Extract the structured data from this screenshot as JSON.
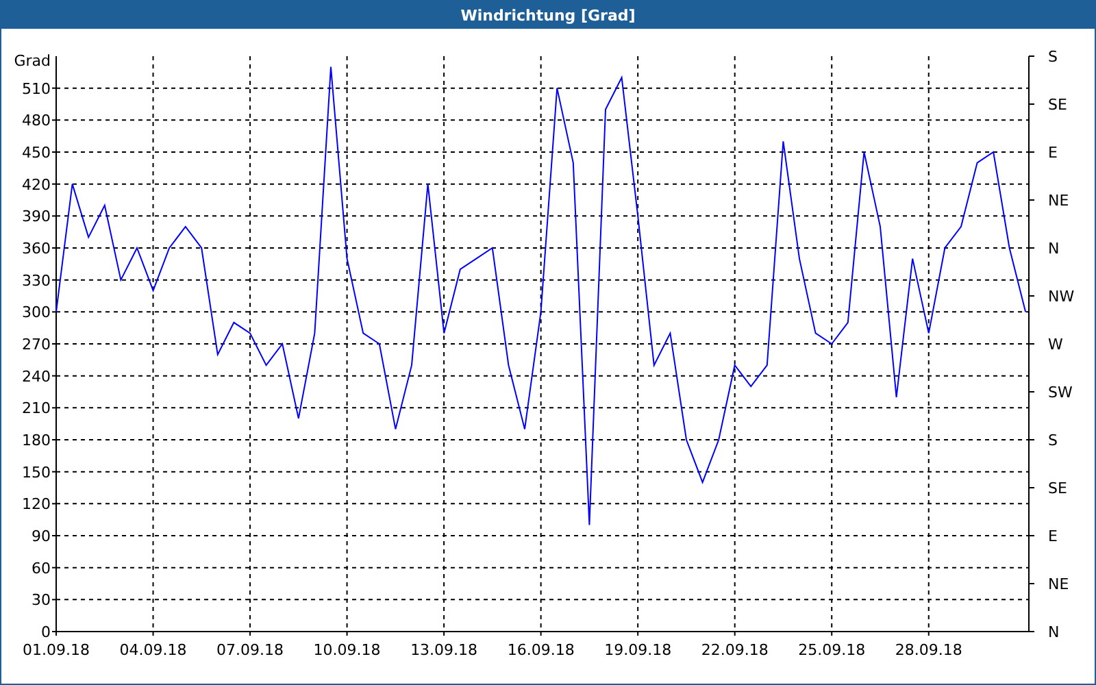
{
  "window": {
    "title": "Windrichtung [Grad]"
  },
  "chart_data": {
    "type": "line",
    "ylabel": "Grad",
    "grid": true,
    "ylim": [
      0,
      540
    ],
    "categories": [
      "01.09.18",
      null,
      null,
      null,
      null,
      null,
      "04.09.18",
      null,
      null,
      null,
      null,
      null,
      "07.09.18",
      null,
      null,
      null,
      null,
      null,
      "10.09.18",
      null,
      null,
      null,
      null,
      null,
      "13.09.18",
      null,
      null,
      null,
      null,
      null,
      "16.09.18",
      null,
      null,
      null,
      null,
      null,
      "19.09.18",
      null,
      null,
      null,
      null,
      null,
      "22.09.18",
      null,
      null,
      null,
      null,
      null,
      "25.09.18",
      null,
      null,
      null,
      null,
      null,
      "28.09.18",
      null,
      null,
      null,
      null,
      null,
      null
    ],
    "series": [
      {
        "color": "#0000ff",
        "values": [
          300,
          420,
          370,
          400,
          330,
          360,
          320,
          360,
          380,
          360,
          260,
          290,
          280,
          250,
          270,
          200,
          280,
          530,
          350,
          280,
          270,
          190,
          250,
          420,
          280,
          340,
          350,
          360,
          250,
          190,
          300,
          510,
          440,
          100,
          490,
          520,
          390,
          250,
          280,
          180,
          140,
          180,
          250,
          230,
          250,
          460,
          350,
          280,
          270,
          290,
          450,
          380,
          220,
          350,
          280,
          360,
          380,
          440,
          450,
          360,
          300
        ]
      }
    ],
    "yticks": [
      0,
      30,
      60,
      90,
      120,
      150,
      180,
      210,
      240,
      270,
      300,
      330,
      360,
      390,
      420,
      450,
      480,
      510
    ]
  },
  "compass_axis": {
    "labels": [
      "S",
      "SE",
      "E",
      "NE",
      "N",
      "NW",
      "W",
      "SW",
      "S",
      "SE",
      "E",
      "NE",
      "N"
    ]
  }
}
